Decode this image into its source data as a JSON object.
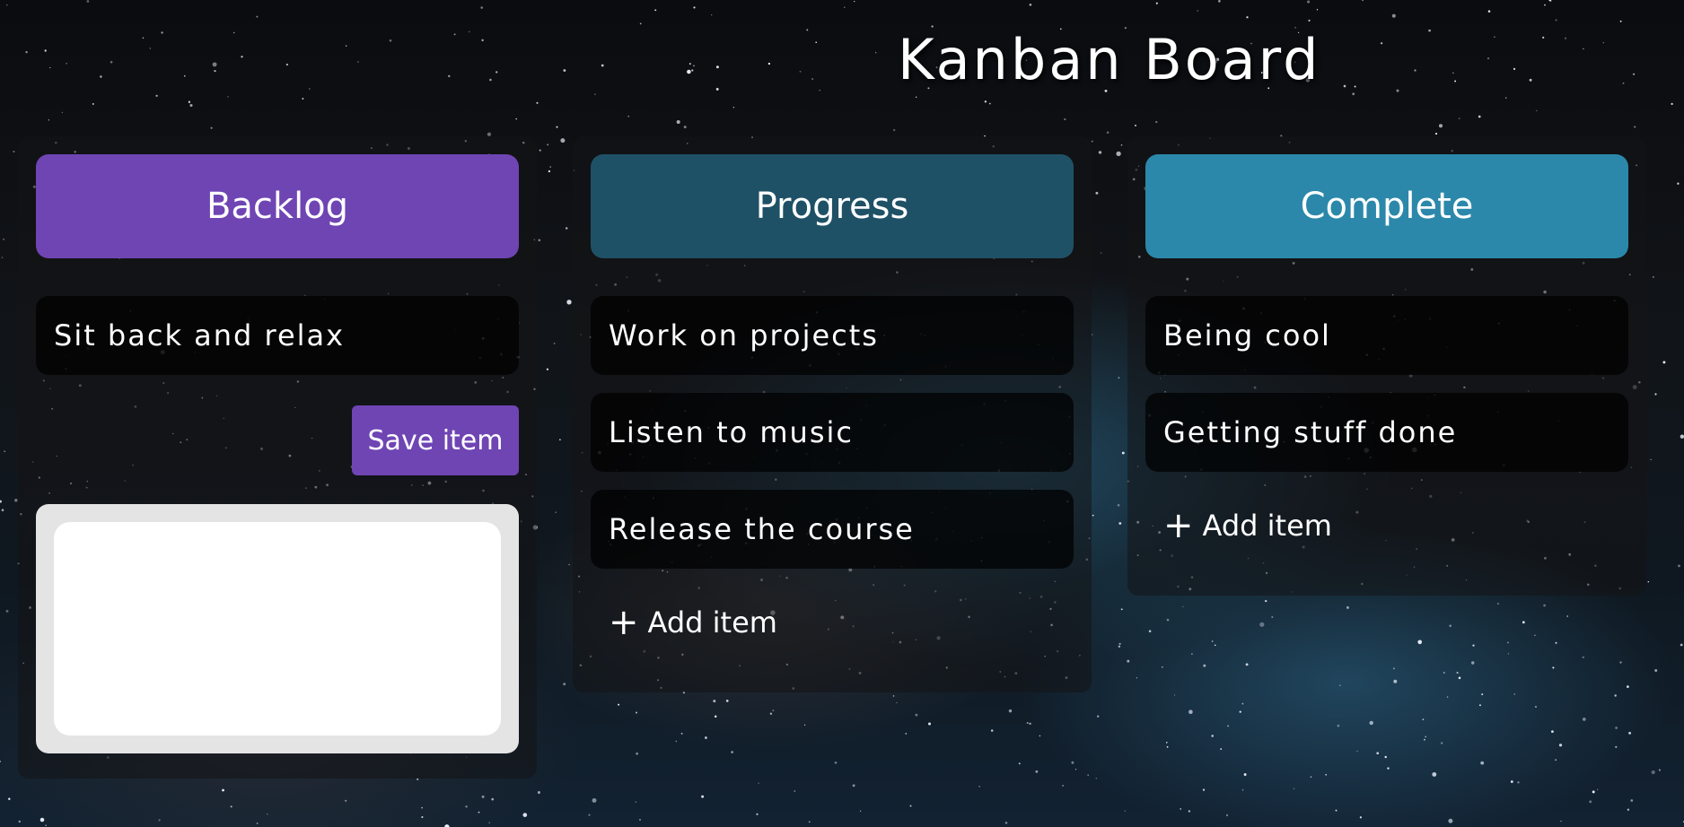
{
  "page": {
    "title": "Kanban Board"
  },
  "columns": [
    {
      "title": "Backlog",
      "color": "#6f45b4",
      "items": [
        "Sit back and relax"
      ],
      "save_label": "Save item",
      "editor_value": ""
    },
    {
      "title": "Progress",
      "color": "#1f5166",
      "items": [
        "Work on projects",
        "Listen to music",
        "Release the course"
      ],
      "add_label": "Add item"
    },
    {
      "title": "Complete",
      "color": "#2b88aa",
      "items": [
        "Being cool",
        "Getting stuff done"
      ],
      "add_label": "Add item"
    }
  ],
  "icons": {
    "plus": "plus-icon"
  },
  "colors": {
    "card_background": "#000000",
    "editor_frame": "#e4e4e4",
    "editor_field": "#ffffff"
  }
}
